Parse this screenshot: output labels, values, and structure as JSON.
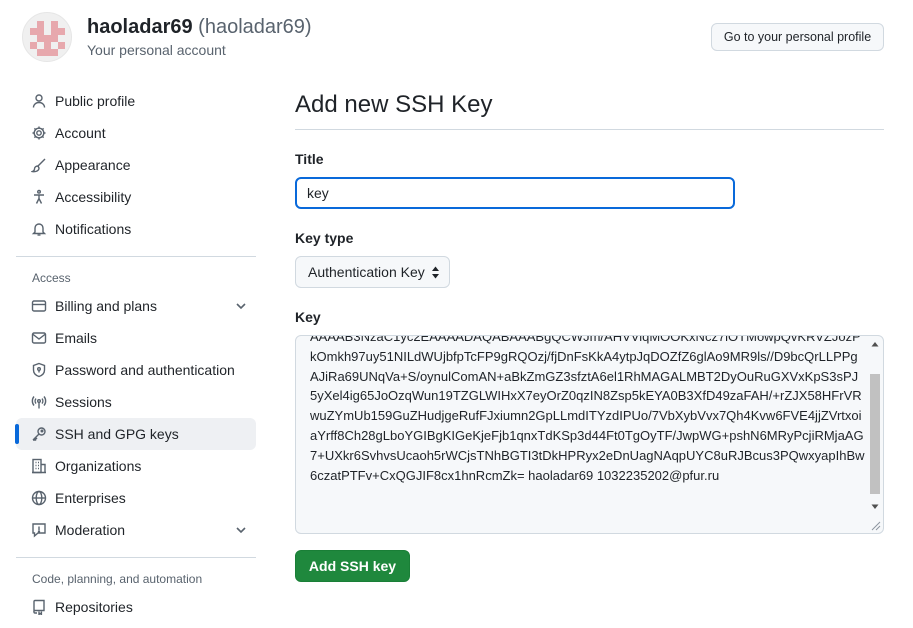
{
  "account": {
    "display_name": "haoladar69",
    "login": "(haoladar69)",
    "subtitle": "Your personal account",
    "profile_button": "Go to your personal profile"
  },
  "sidebar": {
    "top_items": [
      {
        "label": "Public profile",
        "icon": "person-icon"
      },
      {
        "label": "Account",
        "icon": "gear-icon"
      },
      {
        "label": "Appearance",
        "icon": "paintbrush-icon"
      },
      {
        "label": "Accessibility",
        "icon": "accessibility-icon"
      },
      {
        "label": "Notifications",
        "icon": "bell-icon"
      }
    ],
    "access_label": "Access",
    "access_items": [
      {
        "label": "Billing and plans",
        "icon": "credit-card-icon",
        "expandable": true
      },
      {
        "label": "Emails",
        "icon": "mail-icon"
      },
      {
        "label": "Password and authentication",
        "icon": "shield-lock-icon"
      },
      {
        "label": "Sessions",
        "icon": "broadcast-icon"
      },
      {
        "label": "SSH and GPG keys",
        "icon": "key-icon",
        "active": true
      },
      {
        "label": "Organizations",
        "icon": "organization-icon"
      },
      {
        "label": "Enterprises",
        "icon": "globe-icon"
      },
      {
        "label": "Moderation",
        "icon": "report-icon",
        "expandable": true
      }
    ],
    "code_label": "Code, planning, and automation",
    "code_items": [
      {
        "label": "Repositories",
        "icon": "repo-icon"
      }
    ]
  },
  "main": {
    "title": "Add new SSH Key",
    "title_label": "Title",
    "title_value": "key",
    "key_type_label": "Key type",
    "key_type_value": "Authentication Key",
    "key_label": "Key",
    "key_value": "AAAAB3NzaC1yc2EAAAADAQABAAABgQCWJm/AHVViqMOOKxNcz7lOTMowpQvKRVZJozPkOmkh97uy51NILdWUjbfpTcFP9gRQOzj/fjDnFsKkA4ytpJqDOZfZ6glAo9MR9ls//D9bcQrLLPPgAJiRa69UNqVa+S/oynulComAN+aBkZmGZ3sfztA6el1RhMAGALMBT2DyOuRuGXVxKpS3sPJ5yXel4ig65JoOzqWun19TZGLWIHxX7eyOrZ0qzIN8Zsp5kEYA0B3XfD49zaFAH/+rZJX58HFrVRwuZYmUb159GuZHudjgeRufFJxiumn2GpLLmdITYzdIPUo/7VbXybVvx7Qh4Kvw6FVE4jjZVrtxoiaYrff8Ch28gLboYGIBgKIGeKjeFjb1qnxTdKSp3d44Ft0TgOyTF/JwpWG+pshN6MRyPcjiRMjaAG7+UXkr6SvhvsUcaoh5rWCjsTNhBGTI3tDkHPRyx2eDnUagNAqpUYC8uRJBcus3PQwxyapIhBw6czatPTFv+CxQGJIF8cx1hnRcmZk= haoladar69 1032235202@pfur.ru",
    "submit_label": "Add SSH key"
  },
  "colors": {
    "accent": "#0969da",
    "primary_button": "#1f883d",
    "avatar_pink": "#e7a8ad"
  }
}
